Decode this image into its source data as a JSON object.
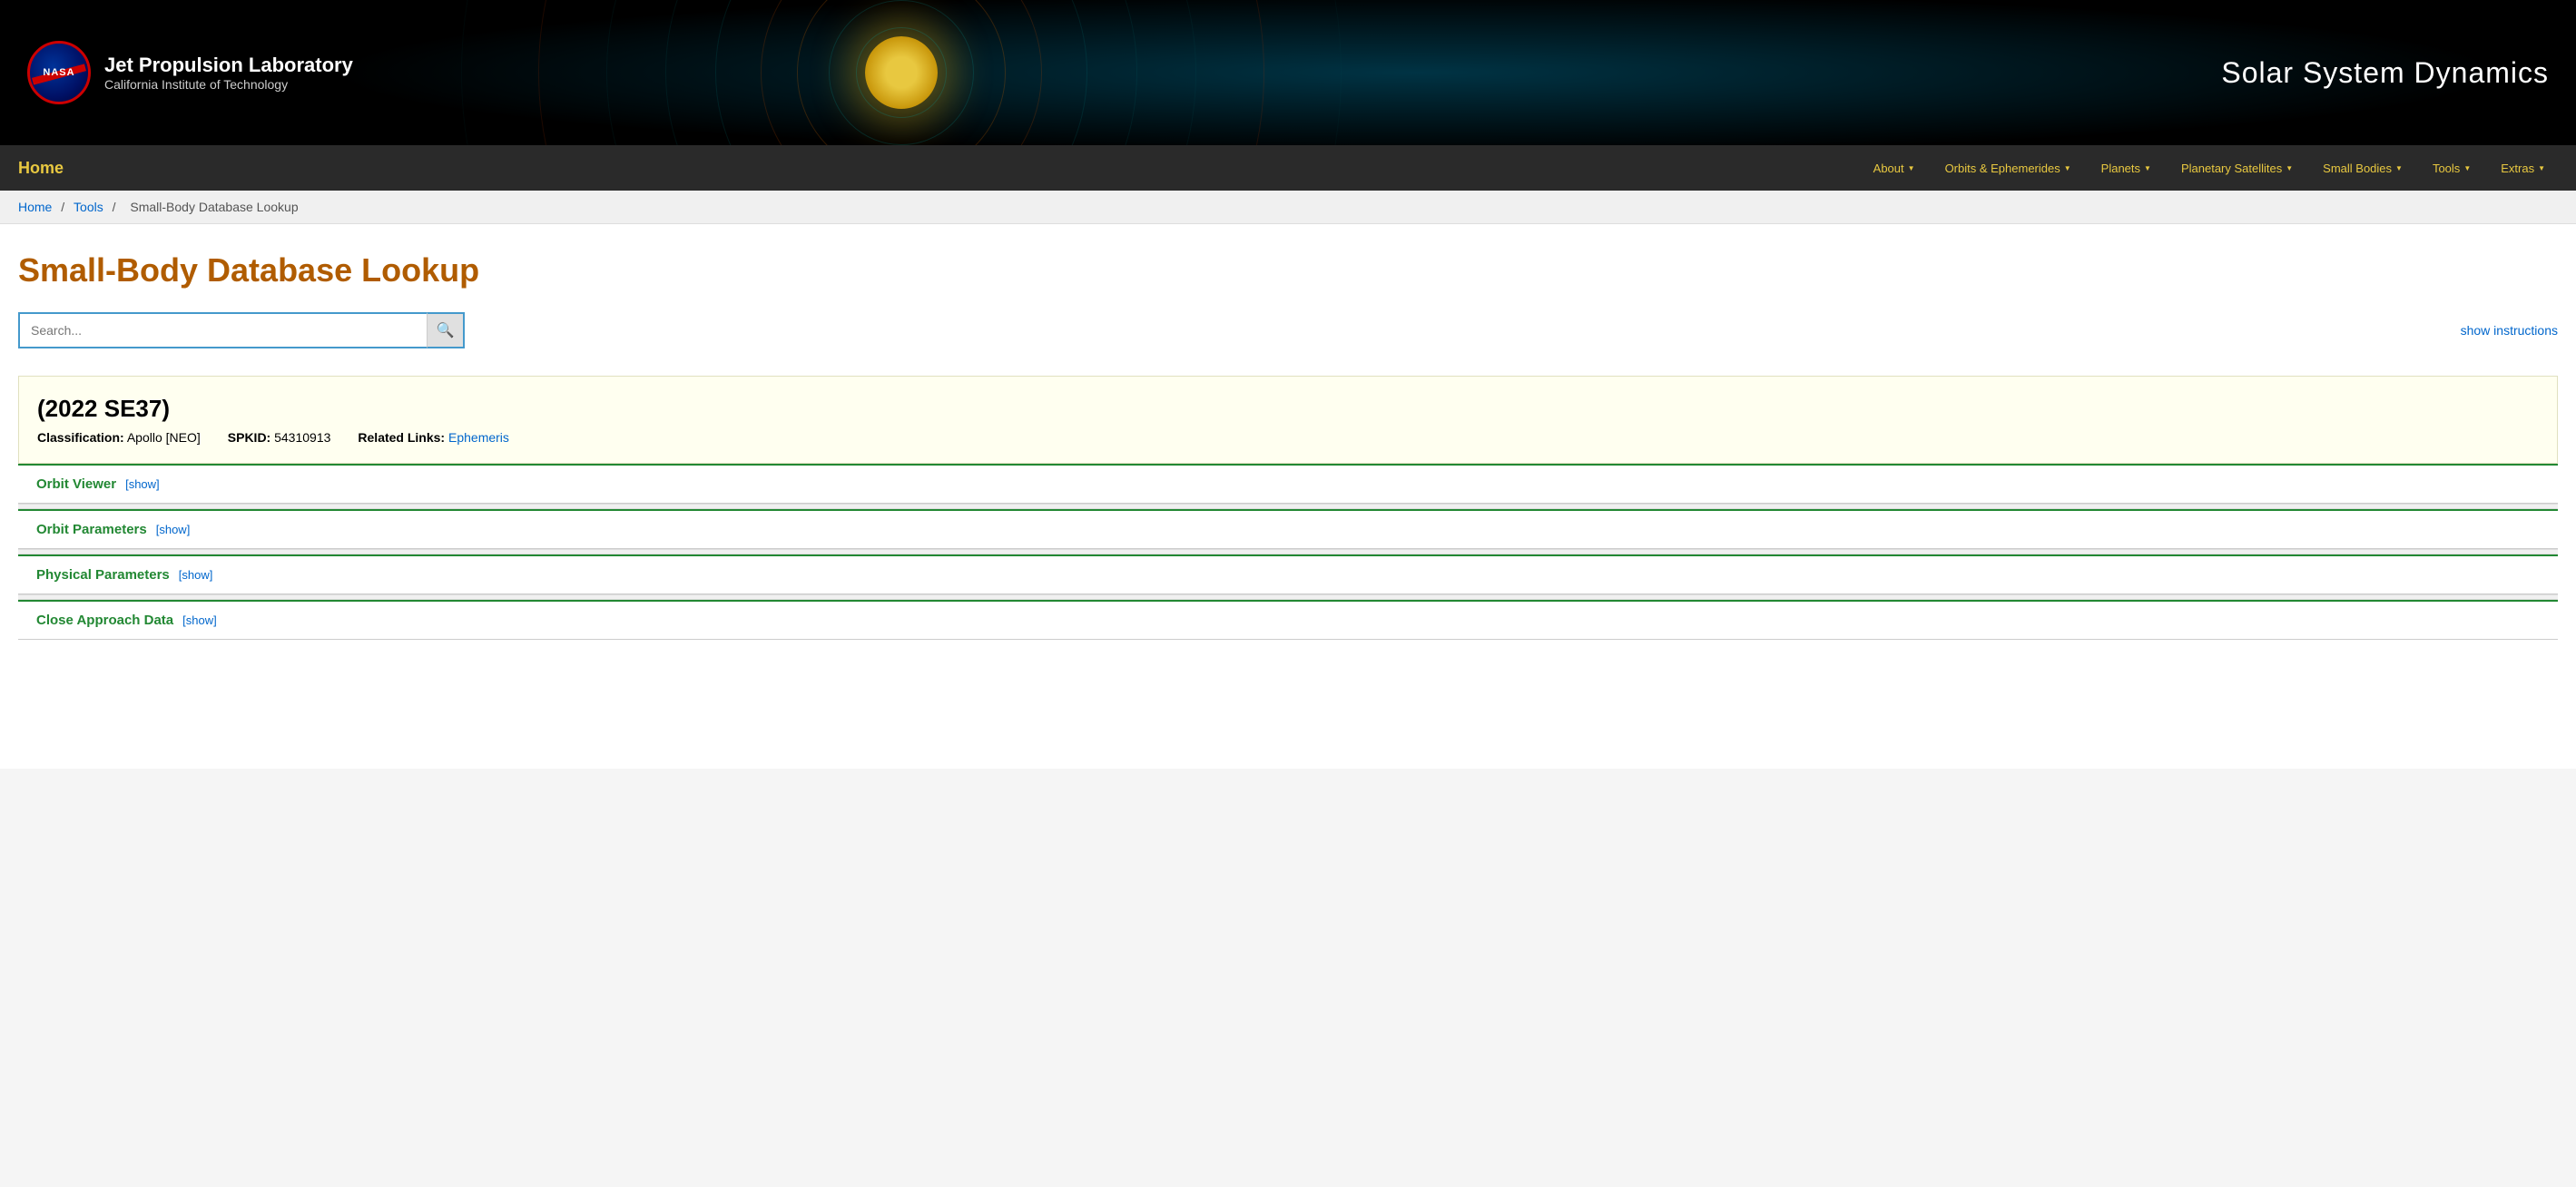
{
  "header": {
    "nasa_logo_text": "NASA",
    "jpl_title": "Jet Propulsion Laboratory",
    "jpl_subtitle": "California Institute of Technology",
    "site_title": "Solar System Dynamics"
  },
  "navbar": {
    "home_label": "Home",
    "items": [
      {
        "id": "about",
        "label": "About",
        "has_dropdown": true
      },
      {
        "id": "orbits",
        "label": "Orbits & Ephemerides",
        "has_dropdown": true
      },
      {
        "id": "planets",
        "label": "Planets",
        "has_dropdown": true
      },
      {
        "id": "planetary-satellites",
        "label": "Planetary Satellites",
        "has_dropdown": true
      },
      {
        "id": "small-bodies",
        "label": "Small Bodies",
        "has_dropdown": true
      },
      {
        "id": "tools",
        "label": "Tools",
        "has_dropdown": true
      },
      {
        "id": "extras",
        "label": "Extras",
        "has_dropdown": true
      }
    ]
  },
  "breadcrumb": {
    "items": [
      {
        "label": "Home",
        "href": true
      },
      {
        "label": "Tools",
        "href": true
      },
      {
        "label": "Small-Body Database Lookup",
        "href": false
      }
    ]
  },
  "main": {
    "page_title": "Small-Body Database Lookup",
    "search_placeholder": "Search...",
    "search_button_icon": "🔍",
    "show_instructions_label": "show instructions",
    "result": {
      "title": "(2022 SE37)",
      "classification_label": "Classification:",
      "classification_value": "Apollo [NEO]",
      "spkid_label": "SPKID:",
      "spkid_value": "54310913",
      "related_links_label": "Related Links:",
      "related_links_value": "Ephemeris"
    },
    "sections": [
      {
        "id": "orbit-viewer",
        "label": "Orbit Viewer",
        "show_label": "[show]"
      },
      {
        "id": "orbit-parameters",
        "label": "Orbit Parameters",
        "show_label": "[show]"
      },
      {
        "id": "physical-parameters",
        "label": "Physical Parameters",
        "show_label": "[show]"
      },
      {
        "id": "close-approach-data",
        "label": "Close Approach Data",
        "show_label": "[show]"
      }
    ]
  }
}
